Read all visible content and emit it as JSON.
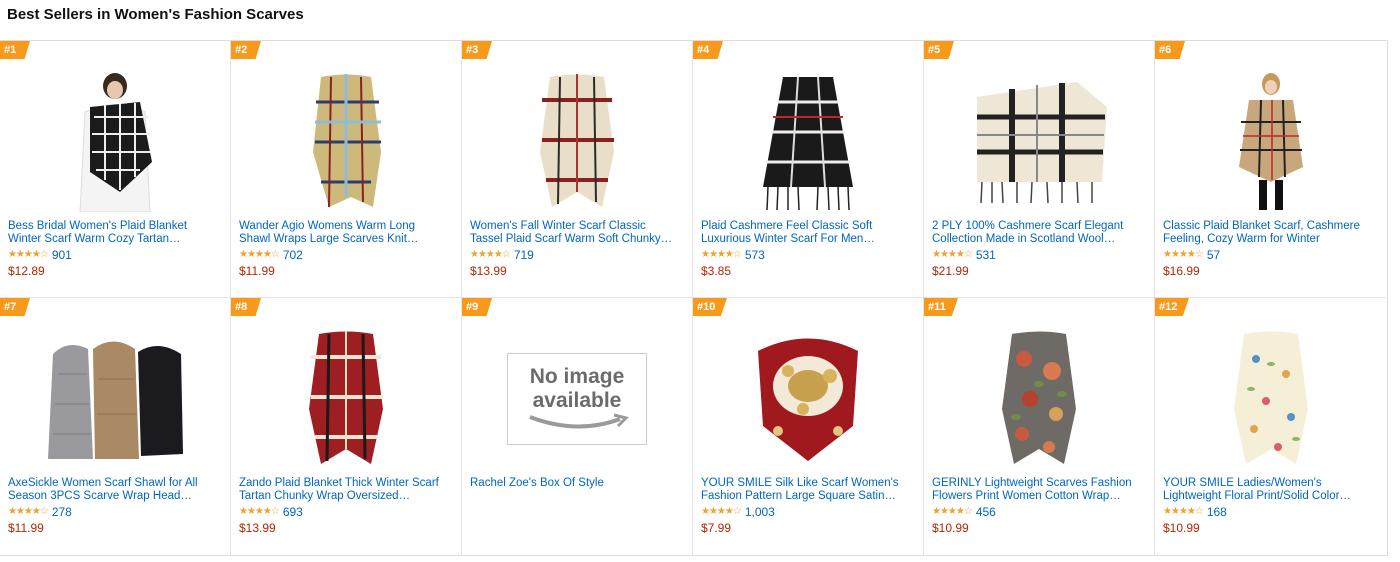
{
  "page": {
    "title": "Best Sellers in Women's Fashion Scarves"
  },
  "colors": {
    "rank_badge": "#F79A1C",
    "link": "#0066C0",
    "price": "#B12704",
    "star": "#F0A12E"
  },
  "products": [
    {
      "rank": "#1",
      "title": "Bess Bridal Women's Plaid Blanket Winter Scarf Warm Cozy Tartan…",
      "stars": "★★★★☆",
      "rating_count": "901",
      "price": "$12.89",
      "image": "scarf-black-white-plaid"
    },
    {
      "rank": "#2",
      "title": "Wander Agio Womens Warm Long Shawl Wraps Large Scarves Knit…",
      "stars": "★★★★☆",
      "rating_count": "702",
      "price": "$11.99",
      "image": "scarf-multicolor-plaid"
    },
    {
      "rank": "#3",
      "title": "Women's Fall Winter Scarf Classic Tassel Plaid Scarf Warm Soft Chunky…",
      "stars": "★★★★☆",
      "rating_count": "719",
      "price": "$13.99",
      "image": "scarf-red-plaid"
    },
    {
      "rank": "#4",
      "title": "Plaid Cashmere Feel Classic Soft Luxurious Winter Scarf For Men…",
      "stars": "★★★★☆",
      "rating_count": "573",
      "price": "$3.85",
      "image": "scarf-black-white-fringe"
    },
    {
      "rank": "#5",
      "title": "2 PLY 100% Cashmere Scarf Elegant Collection Made in Scotland Wool…",
      "stars": "★★★★☆",
      "rating_count": "531",
      "price": "$21.99",
      "image": "scarf-cream-check"
    },
    {
      "rank": "#6",
      "title": "Classic Plaid Blanket Scarf, Cashmere Feeling, Cozy Warm for Winter",
      "stars": "★★★★☆",
      "rating_count": "57",
      "price": "$16.99",
      "image": "scarf-camel-plaid-model"
    },
    {
      "rank": "#7",
      "title": "AxeSickle Women Scarf Shawl for All Season 3PCS Scarve Wrap Head…",
      "stars": "★★★★☆",
      "rating_count": "278",
      "price": "$11.99",
      "image": "scarf-three-solid"
    },
    {
      "rank": "#8",
      "title": "Zando Plaid Blanket Thick Winter Scarf Tartan Chunky Wrap Oversized…",
      "stars": "★★★★☆",
      "rating_count": "693",
      "price": "$13.99",
      "image": "scarf-red-tartan"
    },
    {
      "rank": "#9",
      "title": "Rachel Zoe's Box Of Style",
      "stars": "",
      "rating_count": "",
      "price": "",
      "image": "no-image",
      "no_image_text": [
        "No image",
        "available"
      ]
    },
    {
      "rank": "#10",
      "title": "YOUR SMILE Silk Like Scarf Women's Fashion Pattern Large Square Satin…",
      "stars": "★★★★☆",
      "rating_count": "1,003",
      "price": "$7.99",
      "image": "scarf-silk-square"
    },
    {
      "rank": "#11",
      "title": "GERINLY Lightweight Scarves Fashion Flowers Print Women Cotton Wrap…",
      "stars": "★★★★☆",
      "rating_count": "456",
      "price": "$10.99",
      "image": "scarf-floral-gray"
    },
    {
      "rank": "#12",
      "title": "YOUR SMILE Ladies/Women's Lightweight Floral Print/Solid Color…",
      "stars": "★★★★☆",
      "rating_count": "168",
      "price": "$10.99",
      "image": "scarf-floral-cream"
    }
  ]
}
